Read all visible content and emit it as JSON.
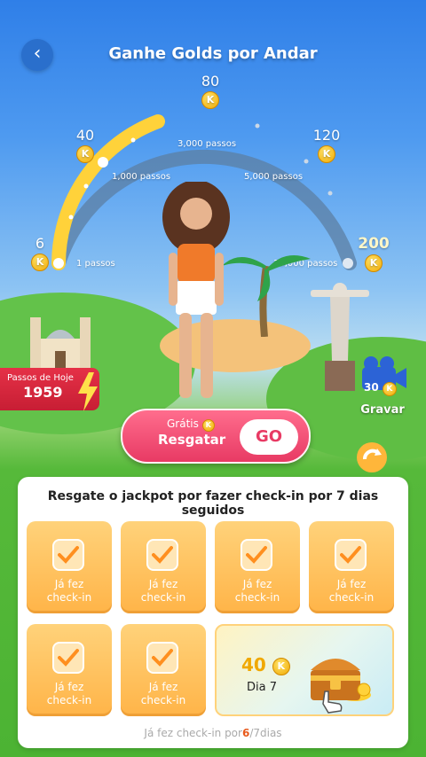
{
  "header": {
    "title": "Ganhe Golds por Andar"
  },
  "gauge": {
    "milestones": [
      {
        "coins": "6",
        "steps": "1 passos",
        "reached": true
      },
      {
        "coins": "40",
        "steps": "1,000 passos",
        "reached": true
      },
      {
        "coins": "80",
        "steps": "3,000 passos",
        "reached": false
      },
      {
        "coins": "120",
        "steps": "5,000 passos",
        "reached": false
      },
      {
        "coins": "200",
        "steps": "10,000 passos",
        "reached": false
      }
    ],
    "coin_symbol": "K"
  },
  "today": {
    "label": "Passos de Hoje",
    "value": "1959"
  },
  "video": {
    "cost": "30",
    "label": "Gravar"
  },
  "claim": {
    "free_label": "Grátis",
    "action_label": "Resgatar",
    "go_label": "GO"
  },
  "checkin": {
    "title": "Resgate o jackpot por fazer check-in por 7 dias seguidos",
    "days": [
      {
        "line1": "Já fez",
        "line2": "check-in"
      },
      {
        "line1": "Já fez",
        "line2": "check-in"
      },
      {
        "line1": "Já fez",
        "line2": "check-in"
      },
      {
        "line1": "Já fez",
        "line2": "check-in"
      },
      {
        "line1": "Já fez",
        "line2": "check-in"
      },
      {
        "line1": "Já fez",
        "line2": "check-in"
      }
    ],
    "day7": {
      "amount": "40",
      "label": "Dia 7"
    },
    "progress": {
      "prefix": "Já fez check-in por",
      "done": "6",
      "total": "/7dias"
    }
  },
  "colors": {
    "accent": "#e83a64",
    "gold": "#f0a800",
    "sky": "#2f7fe8"
  }
}
